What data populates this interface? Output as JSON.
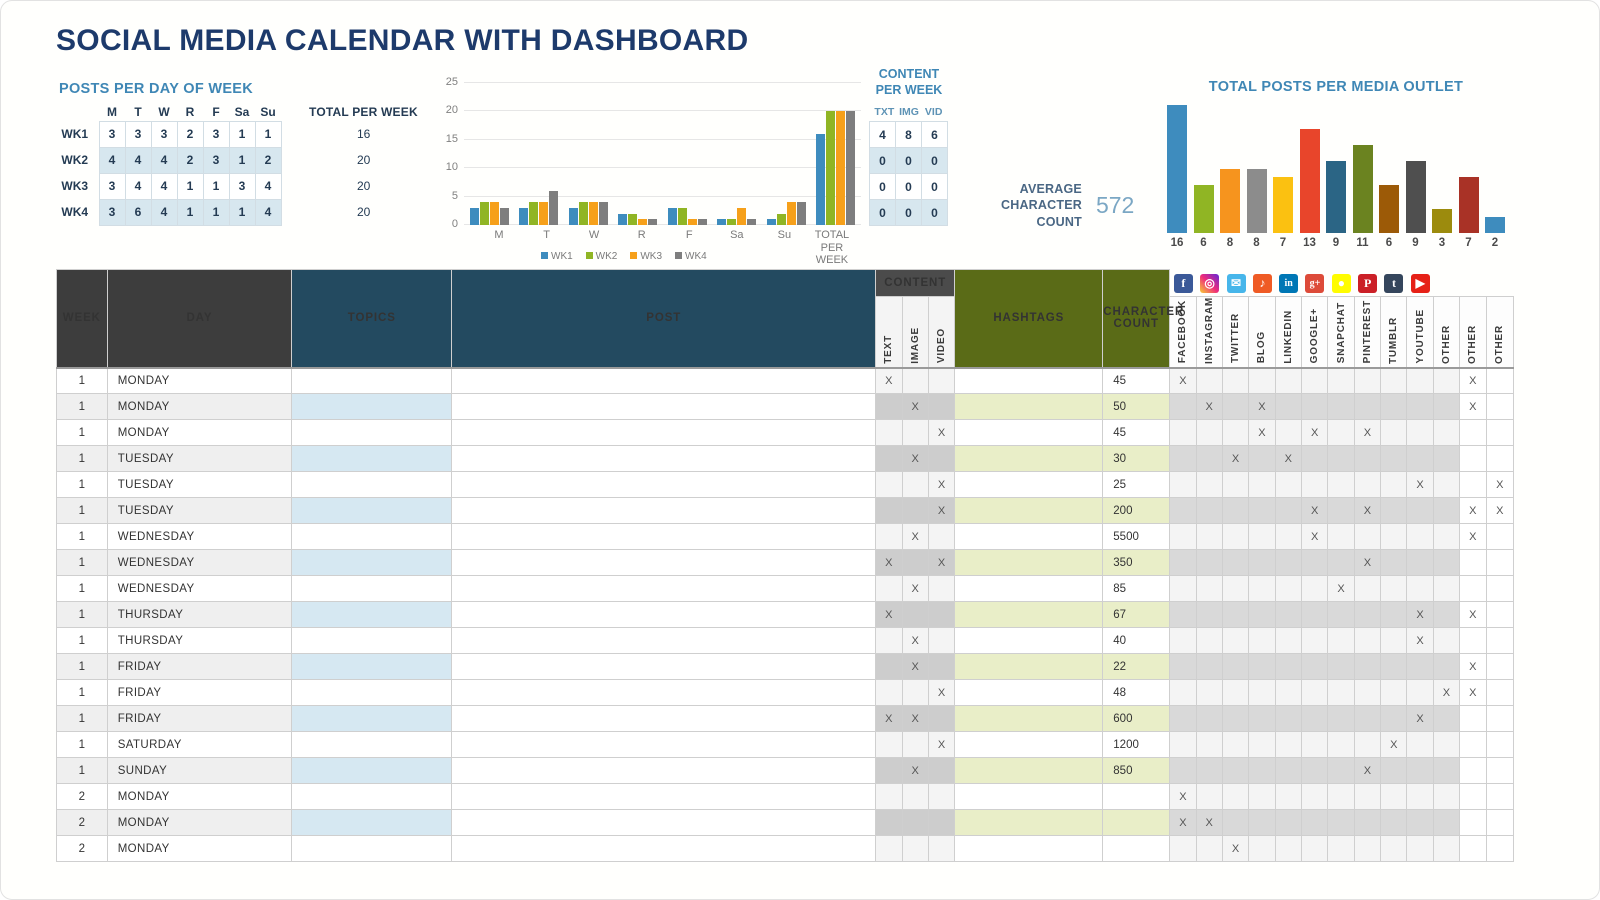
{
  "title": "SOCIAL MEDIA CALENDAR WITH DASHBOARD",
  "dashboard": {
    "posts_per_day": {
      "heading": "POSTS PER DAY OF WEEK",
      "total_header": "TOTAL PER WEEK",
      "day_labels": [
        "M",
        "T",
        "W",
        "R",
        "F",
        "Sa",
        "Su"
      ],
      "rows": [
        {
          "week": "WK1",
          "values": [
            3,
            3,
            3,
            2,
            3,
            1,
            1
          ],
          "total": 16
        },
        {
          "week": "WK2",
          "values": [
            4,
            4,
            4,
            2,
            3,
            1,
            2
          ],
          "total": 20
        },
        {
          "week": "WK3",
          "values": [
            3,
            4,
            4,
            1,
            1,
            3,
            4
          ],
          "total": 20
        },
        {
          "week": "WK4",
          "values": [
            3,
            6,
            4,
            1,
            1,
            1,
            4
          ],
          "total": 20
        }
      ]
    },
    "content_per_week": {
      "heading_line1": "CONTENT",
      "heading_line2": "PER WEEK",
      "columns": [
        "TXT",
        "IMG",
        "VID"
      ],
      "rows": [
        [
          4,
          8,
          6
        ],
        [
          0,
          0,
          0
        ],
        [
          0,
          0,
          0
        ],
        [
          0,
          0,
          0
        ]
      ]
    },
    "average_character_count": {
      "label_line1": "AVERAGE",
      "label_line2": "CHARACTER",
      "label_line3": "COUNT",
      "value": "572"
    }
  },
  "chart_data": [
    {
      "type": "bar",
      "title": "",
      "categories": [
        "M",
        "T",
        "W",
        "R",
        "F",
        "Sa",
        "Su",
        "TOTAL PER WEEK"
      ],
      "series": [
        {
          "name": "WK1",
          "color": "#3e8cbe",
          "values": [
            3,
            3,
            3,
            2,
            3,
            1,
            1,
            16
          ]
        },
        {
          "name": "WK2",
          "color": "#90b524",
          "values": [
            4,
            4,
            4,
            2,
            3,
            1,
            2,
            20
          ]
        },
        {
          "name": "WK3",
          "color": "#f6a01a",
          "values": [
            4,
            4,
            4,
            1,
            1,
            3,
            4,
            20
          ]
        },
        {
          "name": "WK4",
          "color": "#7e7e7e",
          "values": [
            3,
            6,
            4,
            1,
            1,
            1,
            4,
            20
          ]
        }
      ],
      "ylim": [
        0,
        25
      ],
      "yticks": [
        0,
        5,
        10,
        15,
        20,
        25
      ],
      "xlabel": "",
      "ylabel": "",
      "grid": true,
      "legend_position": "bottom"
    },
    {
      "type": "bar",
      "title": "TOTAL POSTS PER MEDIA OUTLET",
      "categories": [
        "FACEBOOK",
        "INSTAGRAM",
        "TWITTER",
        "BLOG",
        "LINKEDIN",
        "GOOGLE+",
        "SNAPCHAT",
        "PINTEREST",
        "TUMBLR",
        "YOUTUBE",
        "OTHER",
        "OTHER",
        "OTHER"
      ],
      "values": [
        16,
        6,
        8,
        8,
        7,
        13,
        9,
        11,
        6,
        9,
        3,
        7,
        2
      ],
      "colors": [
        "#3e8cbe",
        "#90b524",
        "#f6941e",
        "#8c8c8c",
        "#fbc111",
        "#e8452b",
        "#2b6585",
        "#6b8320",
        "#9c5a07",
        "#4f4f4f",
        "#9c8b0d",
        "#a93226",
        "#3e8cbe"
      ],
      "datalabels": [
        16,
        6,
        8,
        8,
        7,
        13,
        9,
        11,
        6,
        9,
        3,
        7,
        2
      ],
      "ylim": [
        0,
        16
      ],
      "grid": false,
      "legend_position": "none"
    }
  ],
  "sheet": {
    "headers": {
      "week": "WEEK",
      "day": "DAY",
      "topics": "TOPICS",
      "post": "POST",
      "content_group": "CONTENT",
      "text": "TEXT",
      "image": "IMAGE",
      "video": "VIDEO",
      "hashtags": "HASHTAGS",
      "character_count": "CHARACTER COUNT"
    },
    "outlets": [
      {
        "name": "FACEBOOK",
        "icon": "facebook-icon",
        "glyph": "f",
        "bg": "#3b5998"
      },
      {
        "name": "INSTAGRAM",
        "icon": "instagram-icon",
        "glyph": "◎",
        "bg": "#c13584"
      },
      {
        "name": "TWITTER",
        "icon": "twitter-icon",
        "glyph": "✉",
        "bg": "#47b6ea"
      },
      {
        "name": "BLOG",
        "icon": "blog-rss-icon",
        "glyph": "♪",
        "bg": "#ef5b25"
      },
      {
        "name": "LINKEDIN",
        "icon": "linkedin-icon",
        "glyph": "in",
        "bg": "#0077b5"
      },
      {
        "name": "GOOGLE+",
        "icon": "google-plus-icon",
        "glyph": "g+",
        "bg": "#dd4b39"
      },
      {
        "name": "SNAPCHAT",
        "icon": "snapchat-icon",
        "glyph": "●",
        "bg": "#fffc00"
      },
      {
        "name": "PINTEREST",
        "icon": "pinterest-icon",
        "glyph": "P",
        "bg": "#cb2027"
      },
      {
        "name": "TUMBLR",
        "icon": "tumblr-icon",
        "glyph": "t",
        "bg": "#35465c"
      },
      {
        "name": "YOUTUBE",
        "icon": "youtube-icon",
        "glyph": "▶",
        "bg": "#e62117"
      },
      {
        "name": "OTHER",
        "icon": "",
        "glyph": "",
        "bg": ""
      },
      {
        "name": "OTHER",
        "icon": "",
        "glyph": "",
        "bg": ""
      },
      {
        "name": "OTHER",
        "icon": "",
        "glyph": "",
        "bg": ""
      }
    ],
    "mark": "X",
    "rows": [
      {
        "week": "1",
        "day": "MONDAY",
        "topics": "",
        "post": "",
        "content": [
          1,
          0,
          0
        ],
        "hashtags": "",
        "count": "45",
        "outlets": [
          1,
          0,
          0,
          0,
          0,
          0,
          0,
          0,
          0,
          0,
          0,
          1,
          0
        ]
      },
      {
        "week": "1",
        "day": "MONDAY",
        "topics": "",
        "post": "",
        "content": [
          0,
          1,
          0
        ],
        "hashtags": "",
        "count": "50",
        "outlets": [
          0,
          1,
          0,
          1,
          0,
          0,
          0,
          0,
          0,
          0,
          0,
          1,
          0
        ]
      },
      {
        "week": "1",
        "day": "MONDAY",
        "topics": "",
        "post": "",
        "content": [
          0,
          0,
          1
        ],
        "hashtags": "",
        "count": "45",
        "outlets": [
          0,
          0,
          0,
          1,
          0,
          1,
          0,
          1,
          0,
          0,
          0,
          0,
          0
        ]
      },
      {
        "week": "1",
        "day": "TUESDAY",
        "topics": "",
        "post": "",
        "content": [
          0,
          1,
          0
        ],
        "hashtags": "",
        "count": "30",
        "outlets": [
          0,
          0,
          1,
          0,
          1,
          0,
          0,
          0,
          0,
          0,
          0,
          0,
          0
        ]
      },
      {
        "week": "1",
        "day": "TUESDAY",
        "topics": "",
        "post": "",
        "content": [
          0,
          0,
          1
        ],
        "hashtags": "",
        "count": "25",
        "outlets": [
          0,
          0,
          0,
          0,
          0,
          0,
          0,
          0,
          0,
          1,
          0,
          0,
          1
        ]
      },
      {
        "week": "1",
        "day": "TUESDAY",
        "topics": "",
        "post": "",
        "content": [
          0,
          0,
          1
        ],
        "hashtags": "",
        "count": "200",
        "outlets": [
          0,
          0,
          0,
          0,
          0,
          1,
          0,
          1,
          0,
          0,
          0,
          1,
          1
        ]
      },
      {
        "week": "1",
        "day": "WEDNESDAY",
        "topics": "",
        "post": "",
        "content": [
          0,
          1,
          0
        ],
        "hashtags": "",
        "count": "5500",
        "outlets": [
          0,
          0,
          0,
          0,
          0,
          1,
          0,
          0,
          0,
          0,
          0,
          1,
          0
        ]
      },
      {
        "week": "1",
        "day": "WEDNESDAY",
        "topics": "",
        "post": "",
        "content": [
          1,
          0,
          1
        ],
        "hashtags": "",
        "count": "350",
        "outlets": [
          0,
          0,
          0,
          0,
          0,
          0,
          0,
          1,
          0,
          0,
          0,
          0,
          0
        ]
      },
      {
        "week": "1",
        "day": "WEDNESDAY",
        "topics": "",
        "post": "",
        "content": [
          0,
          1,
          0
        ],
        "hashtags": "",
        "count": "85",
        "outlets": [
          0,
          0,
          0,
          0,
          0,
          0,
          1,
          0,
          0,
          0,
          0,
          0,
          0
        ]
      },
      {
        "week": "1",
        "day": "THURSDAY",
        "topics": "",
        "post": "",
        "content": [
          1,
          0,
          0
        ],
        "hashtags": "",
        "count": "67",
        "outlets": [
          0,
          0,
          0,
          0,
          0,
          0,
          0,
          0,
          0,
          1,
          0,
          1,
          0
        ]
      },
      {
        "week": "1",
        "day": "THURSDAY",
        "topics": "",
        "post": "",
        "content": [
          0,
          1,
          0
        ],
        "hashtags": "",
        "count": "40",
        "outlets": [
          0,
          0,
          0,
          0,
          0,
          0,
          0,
          0,
          0,
          1,
          0,
          0,
          0
        ]
      },
      {
        "week": "1",
        "day": "FRIDAY",
        "topics": "",
        "post": "",
        "content": [
          0,
          1,
          0
        ],
        "hashtags": "",
        "count": "22",
        "outlets": [
          0,
          0,
          0,
          0,
          0,
          0,
          0,
          0,
          0,
          0,
          0,
          1,
          0
        ]
      },
      {
        "week": "1",
        "day": "FRIDAY",
        "topics": "",
        "post": "",
        "content": [
          0,
          0,
          1
        ],
        "hashtags": "",
        "count": "48",
        "outlets": [
          0,
          0,
          0,
          0,
          0,
          0,
          0,
          0,
          0,
          0,
          1,
          1,
          0
        ]
      },
      {
        "week": "1",
        "day": "FRIDAY",
        "topics": "",
        "post": "",
        "content": [
          1,
          1,
          0
        ],
        "hashtags": "",
        "count": "600",
        "outlets": [
          0,
          0,
          0,
          0,
          0,
          0,
          0,
          0,
          0,
          1,
          0,
          0,
          0
        ]
      },
      {
        "week": "1",
        "day": "SATURDAY",
        "topics": "",
        "post": "",
        "content": [
          0,
          0,
          1
        ],
        "hashtags": "",
        "count": "1200",
        "outlets": [
          0,
          0,
          0,
          0,
          0,
          0,
          0,
          0,
          1,
          0,
          0,
          0,
          0
        ]
      },
      {
        "week": "1",
        "day": "SUNDAY",
        "topics": "",
        "post": "",
        "content": [
          0,
          1,
          0
        ],
        "hashtags": "",
        "count": "850",
        "outlets": [
          0,
          0,
          0,
          0,
          0,
          0,
          0,
          1,
          0,
          0,
          0,
          0,
          0
        ]
      },
      {
        "week": "2",
        "day": "MONDAY",
        "topics": "",
        "post": "",
        "content": [
          0,
          0,
          0
        ],
        "hashtags": "",
        "count": "",
        "outlets": [
          1,
          0,
          0,
          0,
          0,
          0,
          0,
          0,
          0,
          0,
          0,
          0,
          0
        ]
      },
      {
        "week": "2",
        "day": "MONDAY",
        "topics": "",
        "post": "",
        "content": [
          0,
          0,
          0
        ],
        "hashtags": "",
        "count": "",
        "outlets": [
          1,
          1,
          0,
          0,
          0,
          0,
          0,
          0,
          0,
          0,
          0,
          0,
          0
        ]
      },
      {
        "week": "2",
        "day": "MONDAY",
        "topics": "",
        "post": "",
        "content": [
          0,
          0,
          0
        ],
        "hashtags": "",
        "count": "",
        "outlets": [
          0,
          0,
          1,
          0,
          0,
          0,
          0,
          0,
          0,
          0,
          0,
          0,
          0
        ]
      }
    ]
  }
}
